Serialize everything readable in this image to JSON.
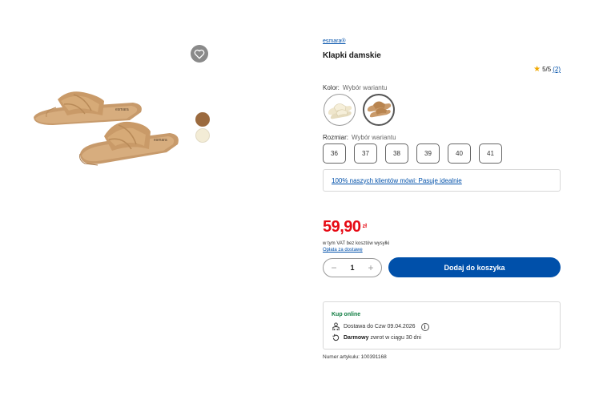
{
  "product": {
    "brand": "esmara®",
    "title": "Klapki damskie",
    "rating_text": "5/5",
    "rating_count": "(2)"
  },
  "options": {
    "color_label": "Kolor:",
    "color_hint": "Wybór wariantu",
    "size_label": "Rozmiar:",
    "size_hint": "Wybór wariantu",
    "sizes": [
      "36",
      "37",
      "38",
      "39",
      "40",
      "41"
    ]
  },
  "fit_link": "100% naszych klientów mówi: Pasuje idealnie",
  "price": {
    "main": "59,90",
    "currency": "zł",
    "vat_note": "w tym VAT bez kosztów wysyłki",
    "shipping_link": "Opłata za dostawę"
  },
  "cart": {
    "quantity": "1",
    "minus": "−",
    "plus": "+",
    "add_label": "Dodaj do koszyka"
  },
  "online": {
    "title": "Kup online",
    "delivery": "Dostawa do Czw 09.04.2026",
    "return_bold": "Darmowy",
    "return_rest": "zwrot w ciągu 30 dni"
  },
  "article": "Numer artykułu: 100391168",
  "colors": {
    "accent": "#0050aa",
    "price": "#e60a14",
    "online": "#0b7a3e",
    "variant_brown": "#9b6a3e",
    "variant_cream": "#f3ecd6"
  },
  "icons": {
    "wishlist": "heart-icon",
    "star": "star-icon",
    "delivery": "delivery-icon",
    "return": "return-icon",
    "info": "info-icon"
  }
}
